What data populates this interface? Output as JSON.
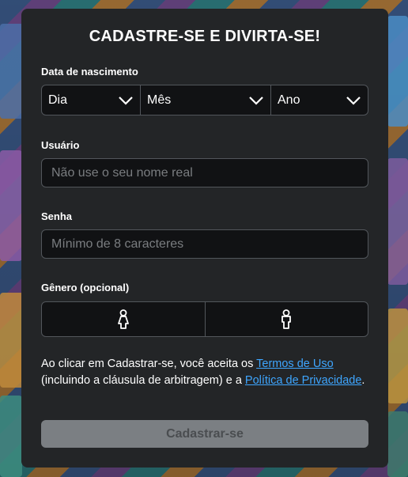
{
  "form": {
    "title": "CADASTRE-SE E DIVIRTA-SE!",
    "birthdate": {
      "label": "Data de nascimento",
      "day": "Dia",
      "month": "Mês",
      "year": "Ano"
    },
    "username": {
      "label": "Usuário",
      "placeholder": "Não use o seu nome real"
    },
    "password": {
      "label": "Senha",
      "placeholder": "Mínimo de 8 caracteres"
    },
    "gender": {
      "label": "Gênero (opcional)",
      "options": [
        "female-icon",
        "male-icon"
      ]
    },
    "terms": {
      "prefix": "Ao clicar em Cadastrar-se, você aceita os ",
      "terms_link": "Termos de Uso",
      "middle": " (incluindo a cláusula de arbitragem) e a ",
      "privacy_link": "Política de Privacidade",
      "suffix": "."
    },
    "submit_label": "Cadastrar-se"
  },
  "colors": {
    "card_bg": "#232527",
    "field_bg": "#111214",
    "link": "#3ea6ff",
    "button_disabled_bg": "#7b7f83"
  }
}
